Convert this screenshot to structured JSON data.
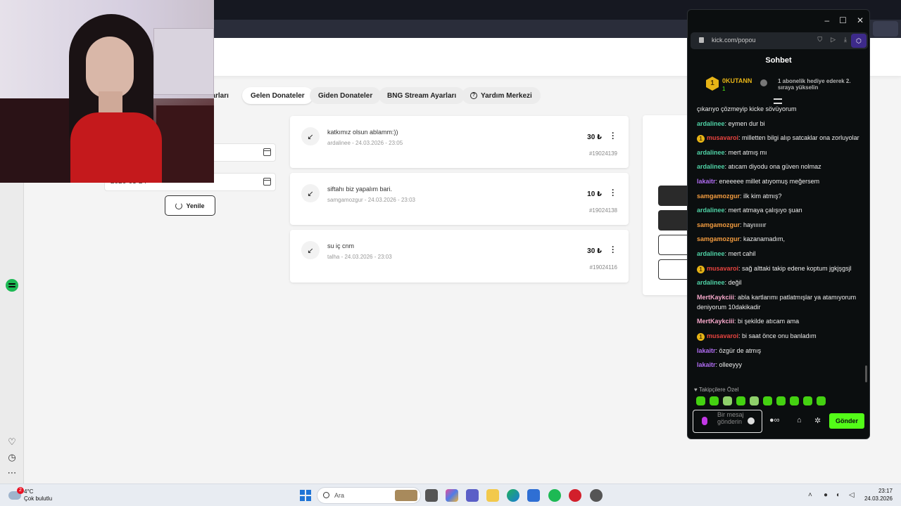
{
  "browser": {
    "url": "kick.com/popou"
  },
  "tabs": [
    {
      "label": "Ayarları",
      "active": false
    },
    {
      "label": "Gelen Donateler",
      "active": true
    },
    {
      "label": "Giden Donateler",
      "active": false
    },
    {
      "label": "BNG Stream Ayarları",
      "active": false
    },
    {
      "label": "Yardım Merkezi",
      "active": false,
      "icon": "help-circle-icon"
    }
  ],
  "filters": {
    "date_end": "2026-03-24",
    "refresh_label": "Yenile"
  },
  "donations": [
    {
      "message": "katkımız olsun ablamm:))",
      "user": "ardalinee",
      "datetime": "24.03.2026 - 23:05",
      "amount": "30 ₺",
      "id": "#19024139"
    },
    {
      "message": "siftahı biz yapalım bari.",
      "user": "samgamozgur",
      "datetime": "24.03.2026 - 23:03",
      "amount": "10 ₺",
      "id": "#19024138"
    },
    {
      "message": "su iç cnm",
      "user": "talha",
      "datetime": "24.03.2026 - 23:03",
      "amount": "30 ₺",
      "id": "#19024116"
    }
  ],
  "chat": {
    "title": "Sohbet",
    "pinned": {
      "rank": "1",
      "username": "0KUTANN",
      "count": "1",
      "text": "1 abonelik hediye ederek 2. sıraya yükselin"
    },
    "messages": [
      {
        "user": "",
        "text": "çıkarıyo çözmeyip kicke sövüyorum",
        "color": "#ededed",
        "badge": false
      },
      {
        "user": "ardalinee",
        "text": "eymen dur bi",
        "color": "#4fd1a5",
        "badge": false
      },
      {
        "user": "musavaroi",
        "text": "milletten bilgi alıp satcaklar ona zorluyolar",
        "color": "#e8433f",
        "badge": true
      },
      {
        "user": "ardalinee",
        "text": "mert atmış mı",
        "color": "#4fd1a5",
        "badge": false
      },
      {
        "user": "ardalinee",
        "text": "atıcam diyodu ona güven nolmaz",
        "color": "#4fd1a5",
        "badge": false
      },
      {
        "user": "lakaitr",
        "text": "eneeeee millet atıyomuş meğersem",
        "color": "#b06cf2",
        "badge": false
      },
      {
        "user": "samgamozgur",
        "text": "ilk kim atmış?",
        "color": "#f39c3f",
        "badge": false
      },
      {
        "user": "ardalinee",
        "text": "mert atmaya çalışıyo şuan",
        "color": "#4fd1a5",
        "badge": false
      },
      {
        "user": "samgamozgur",
        "text": "hayıııııır",
        "color": "#f39c3f",
        "badge": false
      },
      {
        "user": "samgamozgur",
        "text": "kazanamadım,",
        "color": "#f39c3f",
        "badge": false
      },
      {
        "user": "ardalinee",
        "text": "mert cahil",
        "color": "#4fd1a5",
        "badge": false
      },
      {
        "user": "musavaroi",
        "text": "sağ alttaki takip edene koptum jgkjşgsjl",
        "color": "#e8433f",
        "badge": true
      },
      {
        "user": "ardalinee",
        "text": "değil",
        "color": "#4fd1a5",
        "badge": false
      },
      {
        "user": "MertKaykciii",
        "text": "abla kartlarımı patlatmışlar ya atamıyorum deniyorum 10dakikadir",
        "color": "#f4a6c8",
        "badge": false
      },
      {
        "user": "MertKaykciii",
        "text": "bi şekilde atıcam ama",
        "color": "#f4a6c8",
        "badge": false
      },
      {
        "user": "musavaroi",
        "text": "bi saat önce onu banladım",
        "color": "#e8433f",
        "badge": true
      },
      {
        "user": "lakaitr",
        "text": "özgür de atmış",
        "color": "#b06cf2",
        "badge": false
      },
      {
        "user": "lakaitr",
        "text": "olleeyyy",
        "color": "#b06cf2",
        "badge": false
      }
    ],
    "follower_only_label": "Takipçilere Özel",
    "input_placeholder": "Bir mesaj gönderin",
    "send_label": "Gönder"
  },
  "taskbar": {
    "weather_temp": "4°C",
    "weather_condition": "Çok bulutlu",
    "weather_badge": "2",
    "search_placeholder": "Ara",
    "time": "23:17",
    "date": "24.03.2026"
  },
  "colors": {
    "kick_green": "#53fc18",
    "kick_bg": "#0b0e0f",
    "gold": "#e7b416"
  }
}
